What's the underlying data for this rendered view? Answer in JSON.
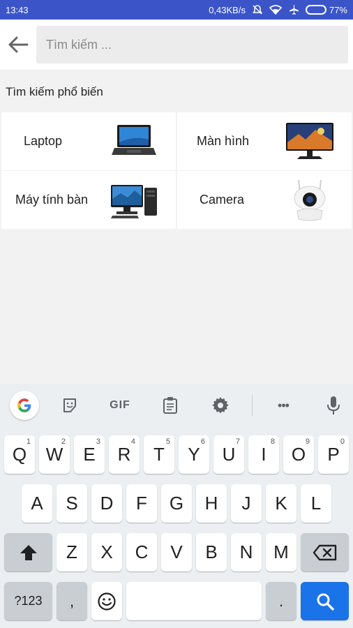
{
  "status_bar": {
    "time": "13:43",
    "network_speed": "0,43KB/s",
    "battery_percent": "77%",
    "battery_level": 0.77,
    "icons": [
      "mute-icon",
      "wifi-icon",
      "airplane-icon",
      "battery-icon"
    ]
  },
  "header": {
    "back_icon": "arrow-left-icon",
    "search_placeholder": "Tìm kiếm ..."
  },
  "popular": {
    "title": "Tìm kiếm phổ biến",
    "items": [
      {
        "label": "Laptop",
        "image": "laptop-image"
      },
      {
        "label": "Màn hình",
        "image": "monitor-image"
      },
      {
        "label": "Máy tính bàn",
        "image": "desktop-pc-image"
      },
      {
        "label": "Camera",
        "image": "security-camera-image"
      }
    ]
  },
  "keyboard": {
    "toolbar": {
      "google": "G",
      "sticker_icon": "sticker-icon",
      "gif": "GIF",
      "clipboard_icon": "clipboard-icon",
      "settings_icon": "gear-icon",
      "more": "•••",
      "mic_icon": "mic-icon"
    },
    "row1": [
      "Q",
      "W",
      "E",
      "R",
      "T",
      "Y",
      "U",
      "I",
      "O",
      "P"
    ],
    "row1_hints": [
      "1",
      "2",
      "3",
      "4",
      "5",
      "6",
      "7",
      "8",
      "9",
      "0"
    ],
    "row2": [
      "A",
      "S",
      "D",
      "F",
      "G",
      "H",
      "J",
      "K",
      "L"
    ],
    "row3": [
      "Z",
      "X",
      "C",
      "V",
      "B",
      "N",
      "M"
    ],
    "symbols_key": "?123",
    "comma_key": ",",
    "period_key": ".",
    "shift_icon": "shift-icon",
    "backspace_icon": "backspace-icon",
    "emoji_icon": "emoji-icon",
    "search_icon": "search-icon",
    "accent": "#1a73e8"
  }
}
